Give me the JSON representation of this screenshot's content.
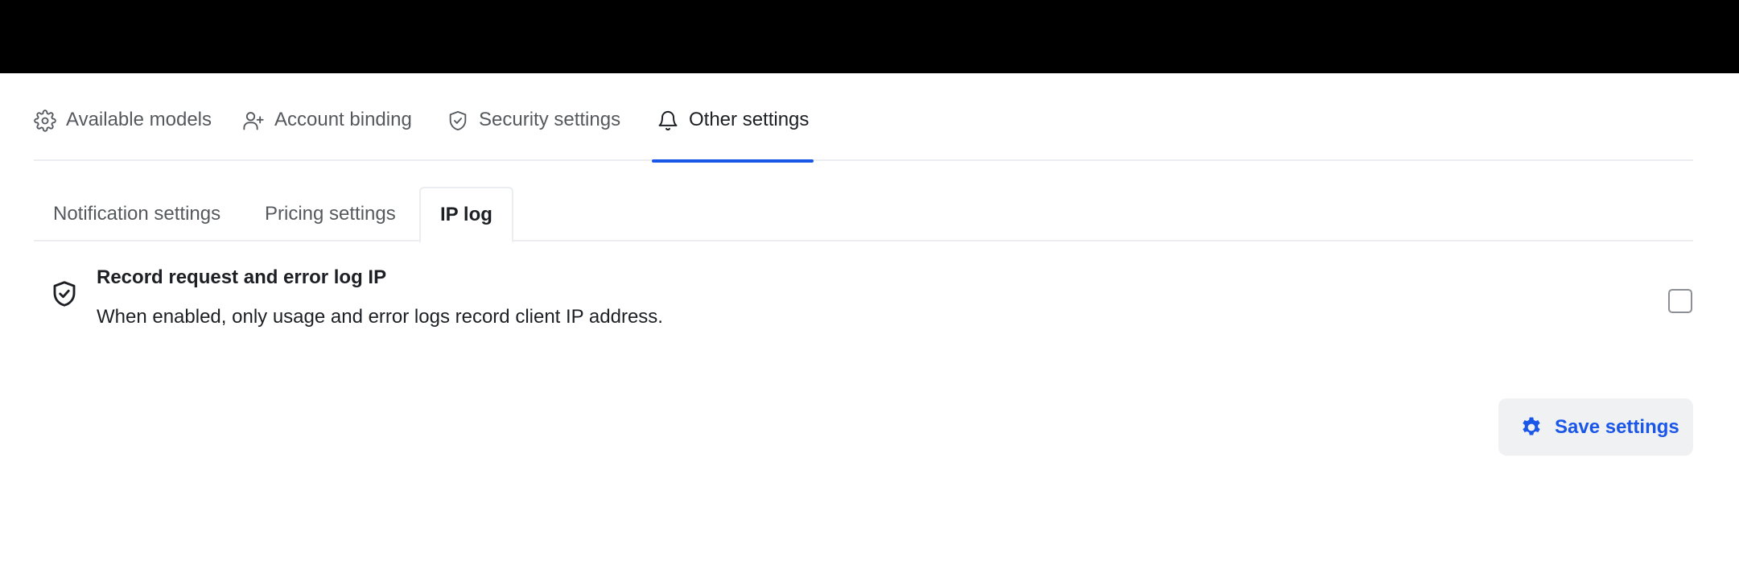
{
  "top_tabs": [
    {
      "label": "Available models",
      "icon": "gear-icon"
    },
    {
      "label": "Account binding",
      "icon": "user-plus-icon"
    },
    {
      "label": "Security settings",
      "icon": "shield-check-icon"
    },
    {
      "label": "Other settings",
      "icon": "bell-icon",
      "active": true
    }
  ],
  "sub_tabs": [
    {
      "label": "Notification settings"
    },
    {
      "label": "Pricing settings"
    },
    {
      "label": "IP log",
      "active": true
    }
  ],
  "setting": {
    "icon": "shield-check-icon",
    "title": "Record request and error log IP",
    "description": "When enabled, only usage and error logs record client IP address.",
    "checked": false
  },
  "save_button": {
    "label": "Save settings",
    "icon": "gear-icon"
  },
  "colors": {
    "accent": "#1a56e8",
    "topbar": "#000000",
    "button_bg": "#f0f1f3"
  }
}
